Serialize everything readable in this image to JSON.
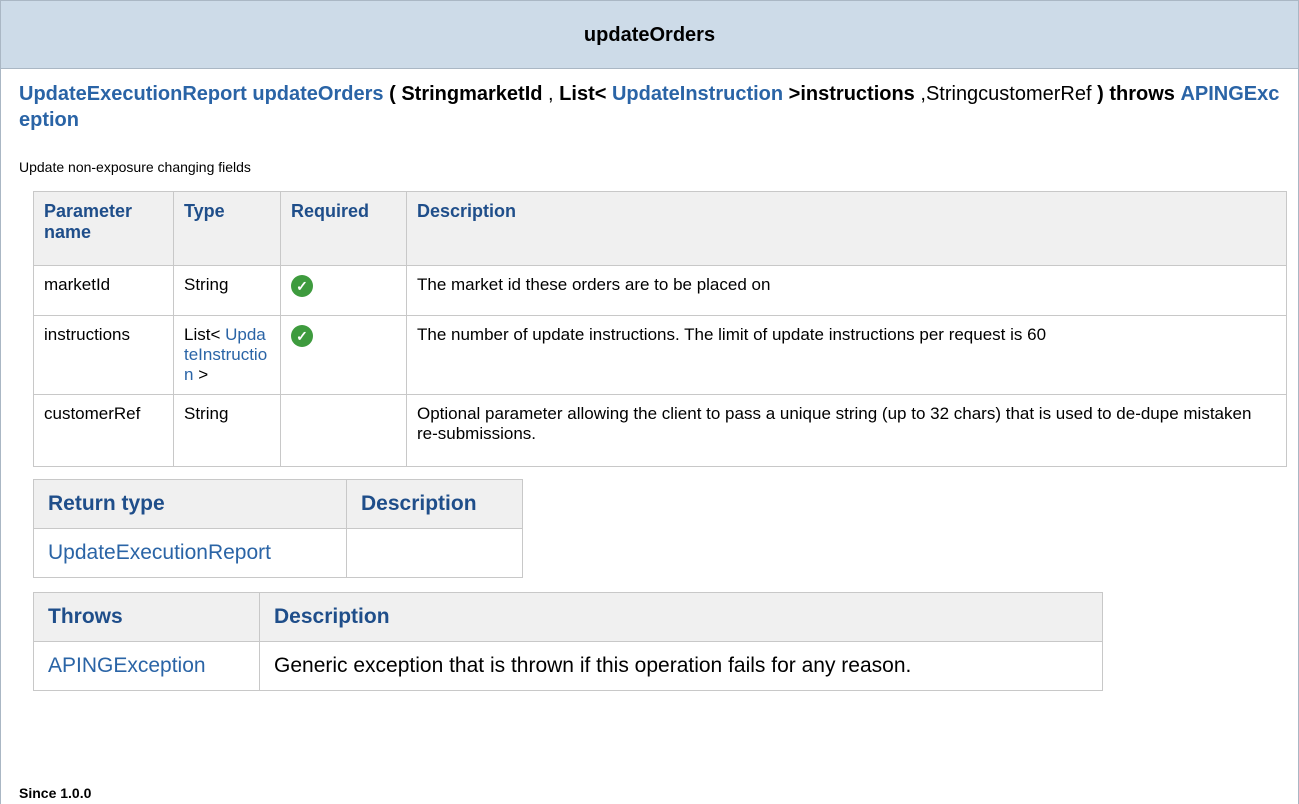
{
  "header": {
    "title": "updateOrders"
  },
  "signature": {
    "return_type": "UpdateExecutionReport",
    "method": "updateOrders",
    "open_paren": "(",
    "p1": "StringmarketId",
    "comma1": ",",
    "p2_prefix": "List<",
    "p2_type": "UpdateInstruction",
    "p2_suffix": ">instructions",
    "comma2": ",",
    "p3": "StringcustomerRef",
    "close": ") throws",
    "exception": "APINGException"
  },
  "summary": "Update non-exposure changing fields",
  "params_table": {
    "headers": [
      "Parameter name",
      "Type",
      "Required",
      "Description"
    ],
    "rows": [
      {
        "name": "marketId",
        "type": "String",
        "required": true,
        "description": "The market id these orders are to be placed on"
      },
      {
        "name": "instructions",
        "type_prefix": "List<",
        "type_link": "UpdateInstruction",
        "type_suffix": ">",
        "required": true,
        "description": "The number of update instructions.  The limit of update instructions per request is 60"
      },
      {
        "name": "customerRef",
        "type": "String",
        "required": false,
        "description": "Optional parameter allowing the client to pass a unique string (up to 32 chars) that is used to de-dupe mistaken re-submissions."
      }
    ]
  },
  "return_table": {
    "headers": [
      "Return type",
      "Description"
    ],
    "rows": [
      {
        "type": "UpdateExecutionReport",
        "description": ""
      }
    ]
  },
  "throws_table": {
    "headers": [
      "Throws",
      "Description"
    ],
    "rows": [
      {
        "type": "APINGException",
        "description": "Generic exception that is thrown if this operation fails for any reason."
      }
    ]
  },
  "since": "Since 1.0.0",
  "colors": {
    "link": "#2a64a6",
    "header_bg": "#cddbe8",
    "check": "#3e9b3e"
  }
}
